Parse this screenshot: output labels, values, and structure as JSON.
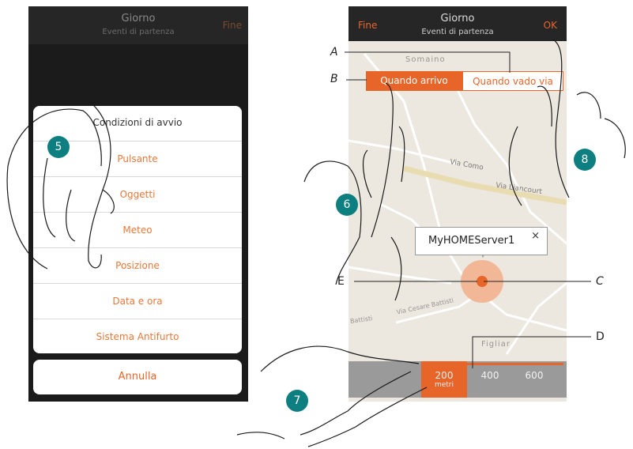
{
  "left": {
    "header_title": "Giorno",
    "header_subtitle": "Eventi di partenza",
    "header_right": "Fine",
    "sheet_title": "Condizioni di avvio",
    "options": [
      "Pulsante",
      "Oggetti",
      "Meteo",
      "Posizione",
      "Data e ora",
      "Sistema Antifurto"
    ],
    "cancel": "Annulla"
  },
  "right": {
    "header_left": "Fine",
    "header_title": "Giorno",
    "header_subtitle": "Eventi di partenza",
    "header_right": "OK",
    "seg_arrive": "Quando arrivo",
    "seg_leave": "Quando vado via",
    "callout": "MyHOMEServer1",
    "callout_close": "×",
    "radius_values": [
      "200",
      "400",
      "600"
    ],
    "radius_unit": "metri",
    "map_labels": {
      "somaino": "Somaino",
      "via_como": "Via Como",
      "via_liancourt": "Via Liancourt",
      "via_cesare_battisti": "Via Cesare Battisti",
      "battisti": "Battisti",
      "figliar": "Figliar"
    }
  },
  "badges": [
    "5",
    "6",
    "7",
    "8"
  ],
  "letters": [
    "A",
    "B",
    "C",
    "D",
    "E"
  ],
  "colors": {
    "accent": "#e8652a",
    "badge": "#0e7f80",
    "map": "#ece7df"
  }
}
